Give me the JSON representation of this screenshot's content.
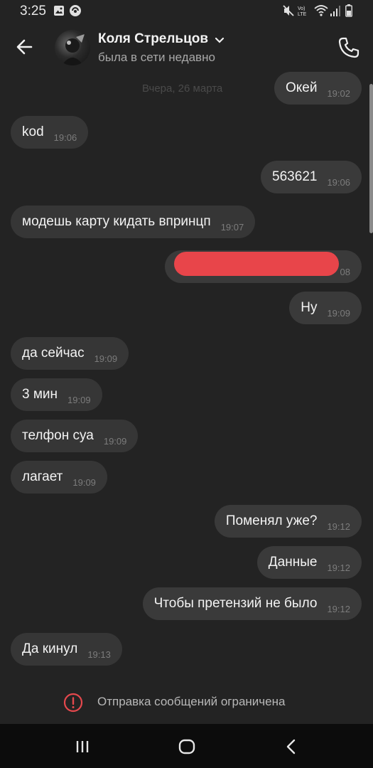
{
  "status_bar": {
    "time": "3:25",
    "volte_label": "Vo) LTE"
  },
  "header": {
    "contact_name": "Коля Стрельцов",
    "contact_status": "была в сети недавно"
  },
  "chat": {
    "date_label": "Вчера, 26 марта",
    "messages": [
      {
        "direction": "out",
        "text": "Окей",
        "time": "19:02"
      },
      {
        "direction": "in",
        "text": "kod",
        "time": "19:06"
      },
      {
        "direction": "out",
        "text": "563621",
        "time": "19:06"
      },
      {
        "direction": "in",
        "text": "модешь карту кидать впринцп",
        "time": "19:07"
      },
      {
        "direction": "out",
        "text": "",
        "time": "08",
        "redacted": true
      },
      {
        "direction": "out",
        "text": "Ну",
        "time": "19:09"
      },
      {
        "direction": "in",
        "text": "да сейчас",
        "time": "19:09"
      },
      {
        "direction": "in",
        "text": "3 мин",
        "time": "19:09"
      },
      {
        "direction": "in",
        "text": "телфон суа",
        "time": "19:09"
      },
      {
        "direction": "in",
        "text": "лагает",
        "time": "19:09"
      },
      {
        "direction": "out",
        "text": "Поменял уже?",
        "time": "19:12"
      },
      {
        "direction": "out",
        "text": "Данные",
        "time": "19:12"
      },
      {
        "direction": "out",
        "text": "Чтобы претензий не было",
        "time": "19:12"
      },
      {
        "direction": "in",
        "text": "Да кинул",
        "time": "19:13"
      }
    ]
  },
  "notice": {
    "text": "Отправка сообщений ограничена"
  },
  "colors": {
    "background": "#232323",
    "bubble": "#363636",
    "redaction": "#e8454a",
    "nav_bar": "#0c0c0c"
  }
}
